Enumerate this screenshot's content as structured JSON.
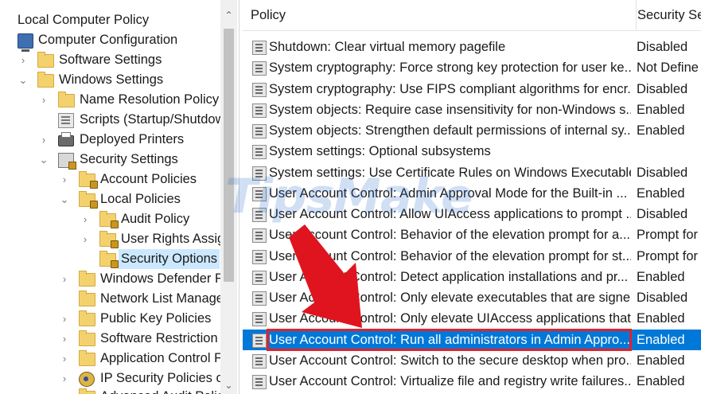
{
  "tree": {
    "items": [
      {
        "label": "Local Computer Policy",
        "chev": "",
        "icon": "none"
      },
      {
        "label": "Computer Configuration",
        "chev": "",
        "icon": "computer"
      },
      {
        "label": "Software Settings",
        "chev": "›",
        "icon": "folder"
      },
      {
        "label": "Windows Settings",
        "chev": "⌄",
        "icon": "folder"
      },
      {
        "label": "Name Resolution Policy",
        "chev": "›",
        "icon": "folder"
      },
      {
        "label": "Scripts (Startup/Shutdow",
        "chev": "",
        "icon": "scripts"
      },
      {
        "label": "Deployed Printers",
        "chev": "›",
        "icon": "printer"
      },
      {
        "label": "Security Settings",
        "chev": "⌄",
        "icon": "security"
      },
      {
        "label": "Account Policies",
        "chev": "›",
        "icon": "lockfolder"
      },
      {
        "label": "Local Policies",
        "chev": "⌄",
        "icon": "lockfolder"
      },
      {
        "label": "Audit Policy",
        "chev": "›",
        "icon": "lockfolder"
      },
      {
        "label": "User Rights Assig",
        "chev": "›",
        "icon": "lockfolder"
      },
      {
        "label": "Security Options",
        "chev": "",
        "icon": "lockfolder"
      },
      {
        "label": "Windows Defender F",
        "chev": "›",
        "icon": "folder"
      },
      {
        "label": "Network List Manage",
        "chev": "",
        "icon": "folder"
      },
      {
        "label": "Public Key Policies",
        "chev": "›",
        "icon": "folder"
      },
      {
        "label": "Software Restriction",
        "chev": "›",
        "icon": "folder"
      },
      {
        "label": "Application Control F",
        "chev": "›",
        "icon": "folder"
      },
      {
        "label": "IP Security Policies or",
        "chev": "›",
        "icon": "ipsec"
      },
      {
        "label": "Advanced Audit Polic",
        "chev": "›",
        "icon": "folder"
      }
    ],
    "selected_label": "Security Options",
    "scroll_up": "⌃",
    "scroll_down": "⌄"
  },
  "list": {
    "columns": {
      "policy": "Policy",
      "setting": "Security Set"
    },
    "rows": [
      {
        "policy": "Shutdown: Clear virtual memory pagefile",
        "setting": "Disabled"
      },
      {
        "policy": "System cryptography: Force strong key protection for user ke...",
        "setting": "Not Define"
      },
      {
        "policy": "System cryptography: Use FIPS compliant algorithms for encr...",
        "setting": "Disabled"
      },
      {
        "policy": "System objects: Require case insensitivity for non-Windows s...",
        "setting": "Enabled"
      },
      {
        "policy": "System objects: Strengthen default permissions of internal sy...",
        "setting": "Enabled"
      },
      {
        "policy": "System settings: Optional subsystems",
        "setting": ""
      },
      {
        "policy": "System settings: Use Certificate Rules on Windows Executable...",
        "setting": "Disabled"
      },
      {
        "policy": "User Account Control: Admin Approval Mode for the Built-in ...",
        "setting": "Enabled"
      },
      {
        "policy": "User Account Control: Allow UIAccess applications to prompt ...",
        "setting": "Disabled"
      },
      {
        "policy": "User Account Control: Behavior of the elevation prompt for a...",
        "setting": "Prompt for"
      },
      {
        "policy": "User Account Control: Behavior of the elevation prompt for st...",
        "setting": "Prompt for"
      },
      {
        "policy": "User Account Control: Detect application installations and pr...",
        "setting": "Enabled"
      },
      {
        "policy": "User Account Control: Only elevate executables that are signe...",
        "setting": "Disabled"
      },
      {
        "policy": "User Account Control: Only elevate UIAccess applications that ...",
        "setting": "Enabled"
      },
      {
        "policy": "User Account Control: Run all administrators in Admin Appro...",
        "setting": "Enabled"
      },
      {
        "policy": "User Account Control: Switch to the secure desktop when pro...",
        "setting": "Enabled"
      },
      {
        "policy": "User Account Control: Virtualize file and registry write failures...",
        "setting": "Enabled"
      }
    ],
    "selected_index": 14
  },
  "watermark": "TipsMake",
  "colors": {
    "selection": "#0078d7",
    "highlight_box": "#e0222b",
    "arrow": "#e0141e"
  }
}
